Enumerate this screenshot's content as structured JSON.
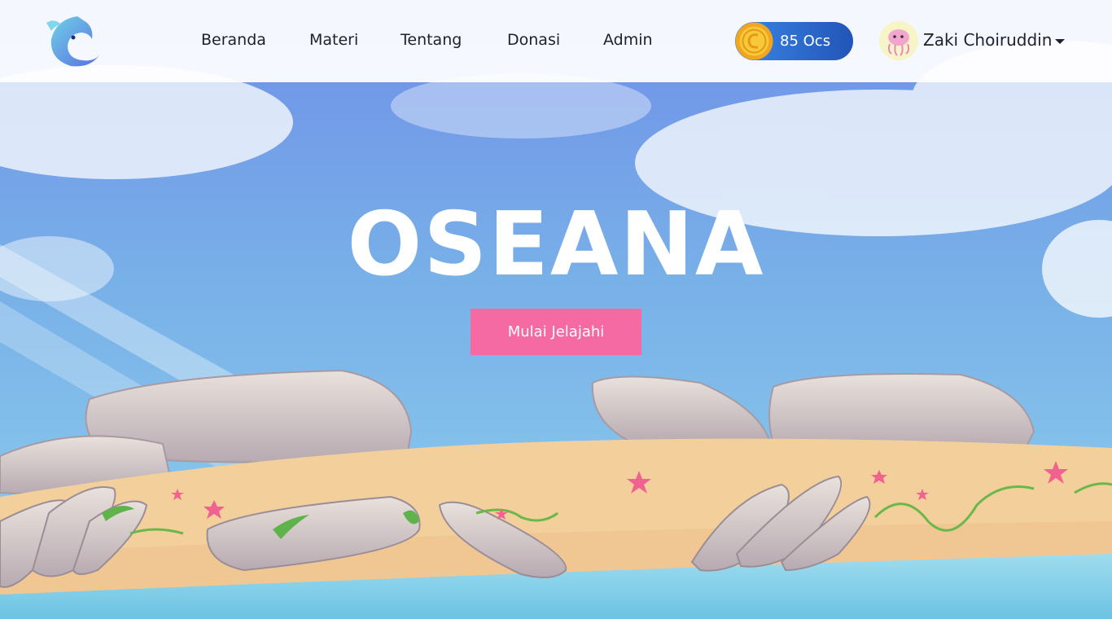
{
  "nav": {
    "logo": "oseana-dolphin-logo",
    "links": [
      "Beranda",
      "Materi",
      "Tentang",
      "Donasi",
      "Admin"
    ]
  },
  "coins": {
    "label": "85 Ocs",
    "icon": "gold-coin-icon"
  },
  "user": {
    "name": "Zaki Choiruddin",
    "avatar": "jellyfish-avatar",
    "menu_icon": "caret-down-icon"
  },
  "hero": {
    "title": "OSEANA",
    "cta_label": "Mulai Jelajahi"
  },
  "colors": {
    "accent_pink": "#f56aa3",
    "coin_pill": "#2a66cc",
    "sky": "#7fb6e6",
    "sand": "#f3cf9c",
    "navbar": "#ffffff"
  }
}
